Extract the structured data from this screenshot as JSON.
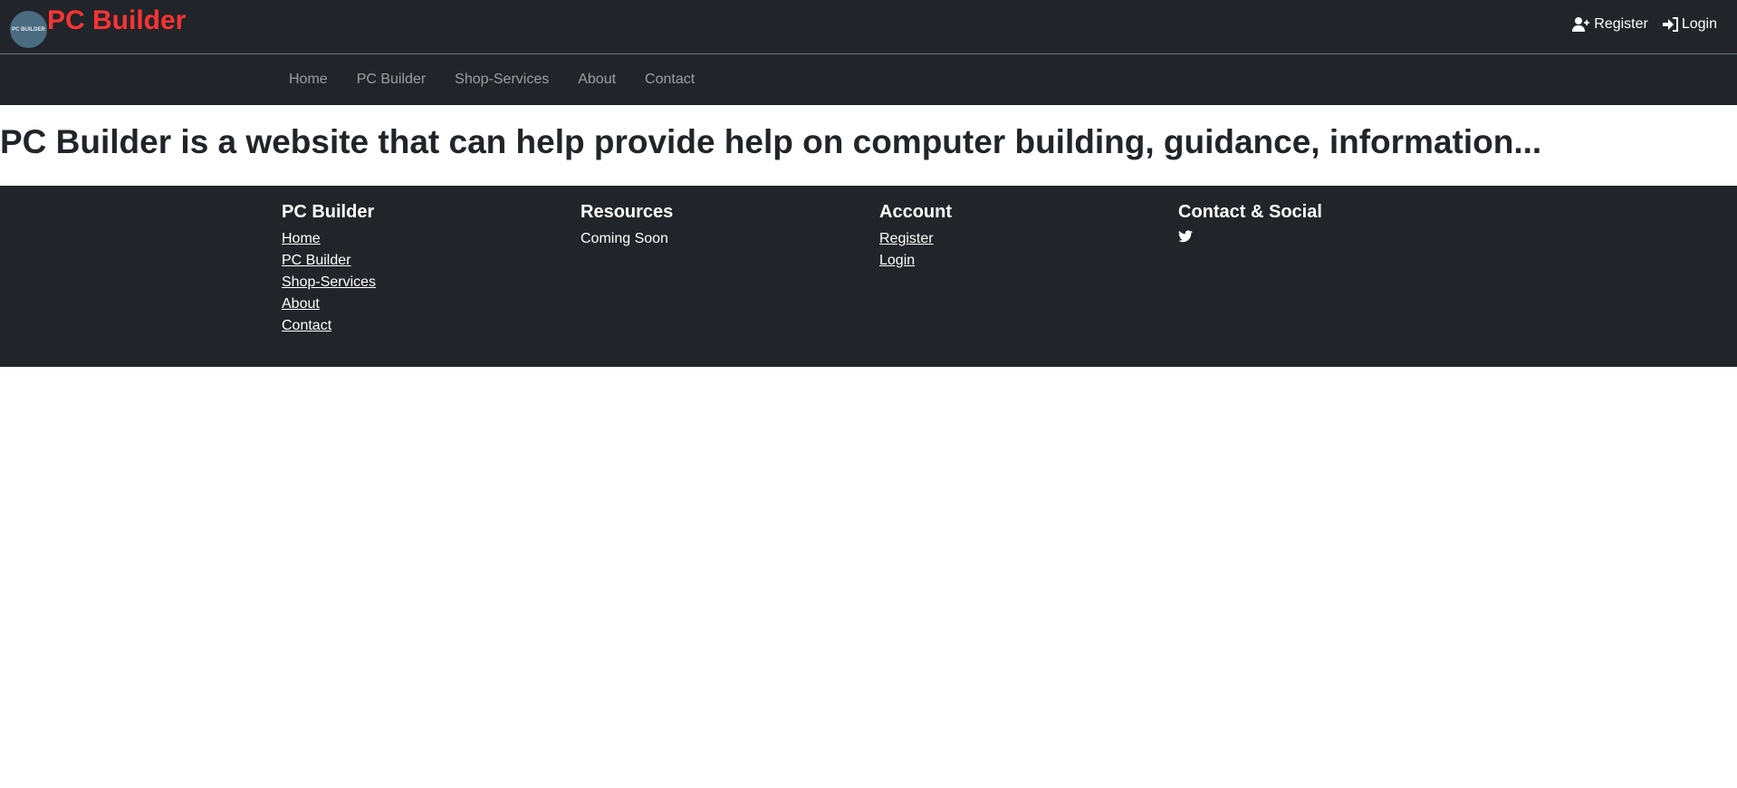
{
  "header": {
    "brand": "PC Builder",
    "logo_text": "PC BUILDER",
    "register": "Register",
    "login": "Login"
  },
  "nav": [
    "Home",
    "PC Builder",
    "Shop-Services",
    "About",
    "Contact"
  ],
  "main": {
    "heading": "PC Builder is a website that can help provide help on computer building, guidance, information..."
  },
  "footer": {
    "col1": {
      "title": "PC Builder",
      "links": [
        "Home",
        "PC Builder",
        "Shop-Services",
        "About",
        "Contact"
      ]
    },
    "col2": {
      "title": "Resources",
      "text": "Coming Soon"
    },
    "col3": {
      "title": "Account",
      "links": [
        "Register",
        "Login"
      ]
    },
    "col4": {
      "title": "Contact & Social",
      "icon": "twitter-icon"
    }
  },
  "colors": {
    "bar": "#212529",
    "brand": "#f83335"
  }
}
